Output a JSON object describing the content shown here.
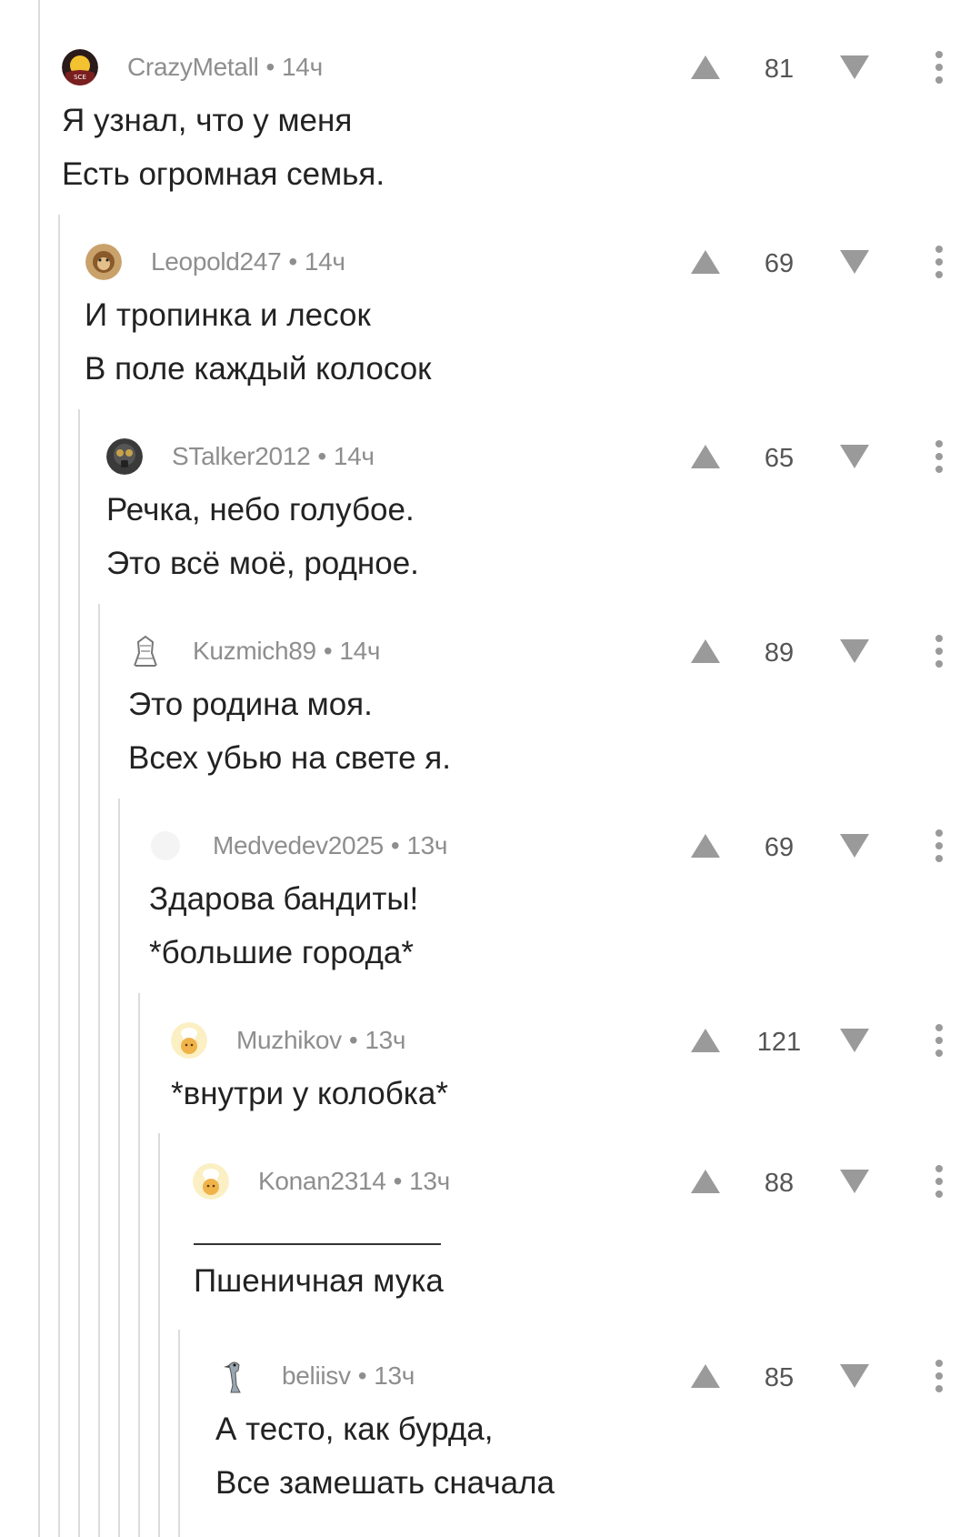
{
  "comments": [
    {
      "author": "CrazyMetall",
      "sep": "•",
      "time": "14ч",
      "score": "81",
      "lines": [
        "Я узнал, что у меня",
        "Есть огромная семья."
      ],
      "avatar": "sunset-avatar"
    },
    {
      "author": "Leopold247",
      "sep": "•",
      "time": "14ч",
      "score": "69",
      "lines": [
        "И тропинка и лесок",
        "В поле каждый колосок"
      ],
      "avatar": "lion-avatar"
    },
    {
      "author": "STalker2012",
      "sep": "•",
      "time": "14ч",
      "score": "65",
      "lines": [
        "Речка, небо голубое.",
        "Это всё моё, родное."
      ],
      "avatar": "gasmask-avatar"
    },
    {
      "author": "Kuzmich89",
      "sep": "•",
      "time": "14ч",
      "score": "89",
      "lines": [
        "Это родина моя.",
        "Всех убью на свете я."
      ],
      "avatar": "sketch-avatar"
    },
    {
      "author": "Medvedev2025",
      "sep": "•",
      "time": "13ч",
      "score": "69",
      "lines": [
        "Здарова бандиты!",
        "*большие города*"
      ],
      "avatar": "blank-avatar"
    },
    {
      "author": "Muzhikov",
      "sep": "•",
      "time": "13ч",
      "score": "121",
      "lines": [
        "*внутри у колобка*"
      ],
      "avatar": "chef-avatar"
    },
    {
      "author": "Konan2314",
      "sep": "•",
      "time": "13ч",
      "score": "88",
      "lines": [
        "Пшеничная мука"
      ],
      "avatar": "chef-avatar"
    },
    {
      "author": "beliisv",
      "sep": "•",
      "time": "13ч",
      "score": "85",
      "lines": [
        "А тесто, как бурда,",
        "Все замешать сначала"
      ],
      "avatar": "bird-avatar"
    }
  ],
  "colors": {
    "text": "#222222",
    "meta": "#8e8e8e",
    "score": "#555555",
    "arrow": "#9a9a9a",
    "thread_line": "#dcdcdc",
    "background": "#ffffff"
  },
  "icons": {
    "upvote": "triangle-up-icon",
    "downvote": "triangle-down-icon",
    "more": "three-dots-vertical-icon"
  }
}
